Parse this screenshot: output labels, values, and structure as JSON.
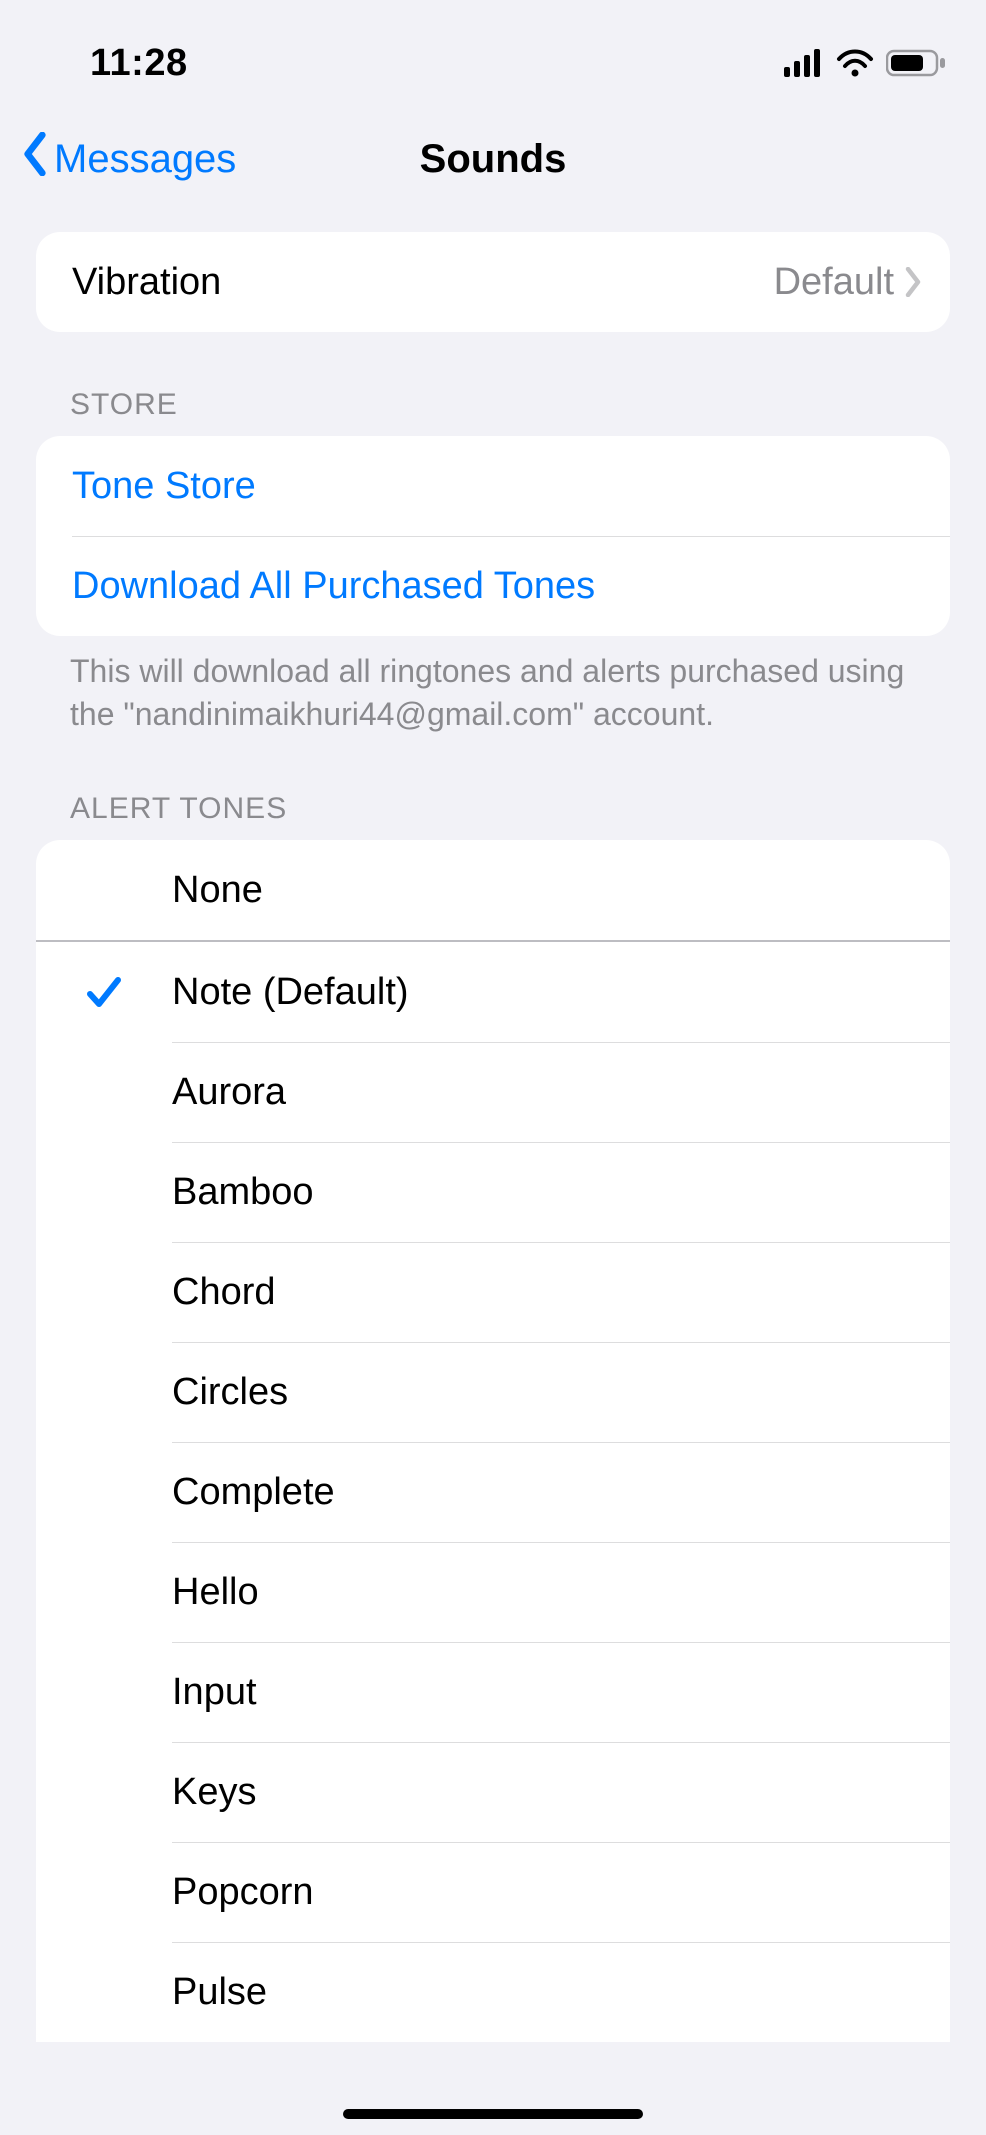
{
  "status": {
    "time": "11:28"
  },
  "nav": {
    "back_label": "Messages",
    "title": "Sounds"
  },
  "vibration": {
    "label": "Vibration",
    "value": "Default"
  },
  "store": {
    "header": "STORE",
    "tone_store": "Tone Store",
    "download_all": "Download All Purchased Tones",
    "footer": "This will download all ringtones and alerts purchased using the \"nandinimaikhuri44@gmail.com\" account."
  },
  "alert_tones": {
    "header": "ALERT TONES",
    "none": "None",
    "selected_index": 0,
    "items": [
      "Note (Default)",
      "Aurora",
      "Bamboo",
      "Chord",
      "Circles",
      "Complete",
      "Hello",
      "Input",
      "Keys",
      "Popcorn",
      "Pulse"
    ]
  }
}
